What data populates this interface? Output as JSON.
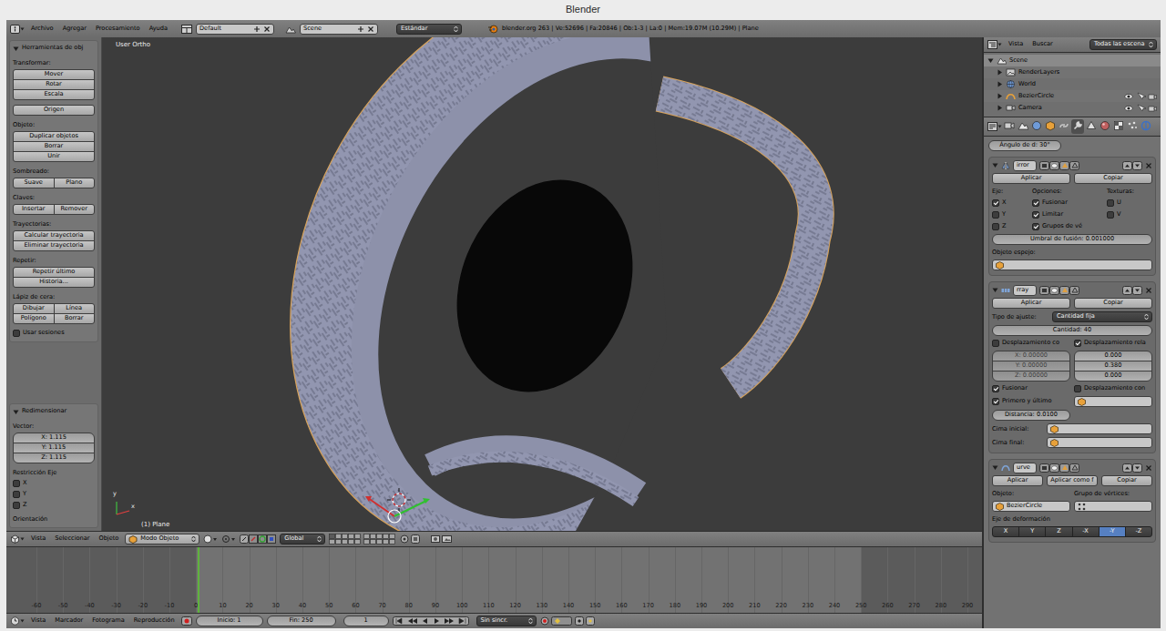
{
  "window": {
    "title": "Blender"
  },
  "info_header": {
    "menus": [
      "Archivo",
      "Agregar",
      "Procesamiento",
      "Ayuda"
    ],
    "screen": "Default",
    "scene": "Scene",
    "engine": "Estándar",
    "stats": "blender.org 263 | Ve:52696 | Fa:20846 | Ob:1-3 | La:0 | Mem:19.07M (10.29M) | Plane"
  },
  "tool_shelf": {
    "title": "Herramientas de obj",
    "expanded": true,
    "sections": [
      {
        "label": "Transformar:",
        "rows": [
          [
            "Mover"
          ],
          [
            "Rotar"
          ],
          [
            "Escala"
          ]
        ]
      },
      {
        "rows": [
          [
            "Origen"
          ]
        ]
      },
      {
        "label": "Objeto:",
        "rows": [
          [
            "Duplicar objetos"
          ],
          [
            "Borrar"
          ],
          [
            "Unir"
          ]
        ]
      },
      {
        "label": "Sombreado:",
        "rows": [
          [
            "Suave",
            "Plano"
          ]
        ]
      },
      {
        "label": "Claves:",
        "rows": [
          [
            "Insertar",
            "Remover"
          ]
        ]
      },
      {
        "label": "Trayectorias:",
        "rows": [
          [
            "Calcular trayectoria"
          ],
          [
            "Eliminar trayectoria"
          ]
        ]
      },
      {
        "label": "Repetir:",
        "rows": [
          [
            "Repetir último"
          ],
          [
            "Historia..."
          ]
        ]
      },
      {
        "label": "Lápiz de cera:",
        "rows": [
          [
            "Dibujar",
            "Línea"
          ],
          [
            "Polígono",
            "Borrar"
          ]
        ],
        "checks": [
          {
            "label": "Usar sesiones",
            "checked": false
          }
        ]
      }
    ]
  },
  "operator_panel": {
    "title": "Redimensionar",
    "expanded": true,
    "vector_label": "Vector:",
    "fields": [
      "X: 1.115",
      "Y: 1.115",
      "Z: 1.115"
    ],
    "constraint_label": "Restricción Eje",
    "axes": [
      {
        "label": "X",
        "checked": false
      },
      {
        "label": "Y",
        "checked": false
      },
      {
        "label": "Z",
        "checked": false
      }
    ],
    "orientation_label": "Orientación"
  },
  "viewport": {
    "view_label": "User Ortho",
    "object_label": "(1) Plane",
    "axis_labels": [
      "y",
      "x"
    ]
  },
  "view_header": {
    "menus": [
      "Vista",
      "Seleccionar",
      "Objeto"
    ],
    "mode": "Modo Objeto",
    "orientation": "Global"
  },
  "timeline": {
    "ticks": [
      "-60",
      "-50",
      "-40",
      "-30",
      "-20",
      "-10",
      "0",
      "10",
      "20",
      "30",
      "40",
      "50",
      "60",
      "70",
      "80",
      "90",
      "100",
      "110",
      "120",
      "130",
      "140",
      "150",
      "160",
      "170",
      "180",
      "190",
      "200",
      "210",
      "220",
      "230",
      "240",
      "250",
      "260",
      "270",
      "280",
      "290"
    ]
  },
  "timeline_header": {
    "menus": [
      "Vista",
      "Marcador",
      "Fotograma",
      "Reproducción"
    ],
    "start": "Inicio: 1",
    "end": "Fin: 250",
    "current_frame": "1",
    "sync": "Sin sincr."
  },
  "outliner": {
    "menus": [
      "Vista",
      "Buscar"
    ],
    "filter": "Todas las escena",
    "items": [
      {
        "label": "Scene",
        "kind": "scene",
        "expanded": true,
        "selected": true,
        "visible": false
      },
      {
        "label": "RenderLayers",
        "kind": "renderlayers",
        "expanded": false,
        "selected": false,
        "visible": false
      },
      {
        "label": "World",
        "kind": "world",
        "expanded": false,
        "selected": false,
        "visible": false
      },
      {
        "label": "BezierCircle",
        "kind": "curve",
        "expanded": false,
        "selected": false,
        "visible": true
      },
      {
        "label": "Camera",
        "kind": "camera",
        "expanded": false,
        "selected": false,
        "visible": true
      }
    ]
  },
  "properties": {
    "tabs": [
      {
        "kind": "render",
        "selected": false
      },
      {
        "kind": "scene",
        "selected": false
      },
      {
        "kind": "world",
        "selected": false
      },
      {
        "kind": "object",
        "selected": false
      },
      {
        "kind": "constraints",
        "selected": false
      },
      {
        "kind": "modifiers",
        "selected": true
      },
      {
        "kind": "data",
        "selected": false
      },
      {
        "kind": "material",
        "selected": false
      },
      {
        "kind": "texture",
        "selected": false
      },
      {
        "kind": "particles",
        "selected": false
      },
      {
        "kind": "physics",
        "selected": false
      }
    ],
    "top_field": "Ángulo de d: 30°",
    "modifiers": [
      {
        "kind": "mirror",
        "name": "irror",
        "expanded": true,
        "buttons": [
          "Aplicar",
          "Copiar"
        ],
        "columns": [
          {
            "title": "Eje:",
            "checks": [
              {
                "label": "X",
                "checked": true
              },
              {
                "label": "Y",
                "checked": false
              },
              {
                "label": "Z",
                "checked": false
              }
            ]
          },
          {
            "title": "Opciones:",
            "checks": [
              {
                "label": "Fusionar",
                "checked": true
              },
              {
                "label": "Limitar",
                "checked": true
              },
              {
                "label": "Grupos de vé",
                "checked": true
              }
            ]
          },
          {
            "title": "Texturas:",
            "checks": [
              {
                "label": "U",
                "checked": false
              },
              {
                "label": "V",
                "checked": false
              }
            ]
          }
        ],
        "merge_limit": "Umbral de fusión: 0.001000",
        "object_label": "Objeto espejo:"
      },
      {
        "kind": "array",
        "name": "rray",
        "expanded": true,
        "buttons": [
          "Aplicar",
          "Copiar"
        ],
        "fit_label": "Tipo de ajuste:",
        "fit_value": "Cantidad fija",
        "count": "Cantidad: 40",
        "offsets": [
          {
            "label": "Desplazamiento co",
            "checked": false,
            "values": [
              "X: 0.00000",
              "Y: 0.00000",
              "Z: 0.00000"
            ]
          },
          {
            "label": "Desplazamiento rela",
            "checked": true,
            "values": [
              "0.000",
              "0.380",
              "0.000"
            ]
          }
        ],
        "merge": {
          "label": "Fusionar",
          "checked": true
        },
        "object_offset": {
          "label": "Desplazamiento con",
          "checked": false
        },
        "first_last": {
          "label": "Primero y último",
          "checked": true
        },
        "distance": "Distancia: 0.0100",
        "caps": [
          "Cima inicial:",
          "Cima final:"
        ]
      },
      {
        "kind": "curve",
        "name": "urve",
        "expanded": true,
        "buttons": [
          "Aplicar",
          "Aplicar como f",
          "Copiar"
        ],
        "object_label": "Objeto:",
        "object_value": "BezierCircle",
        "vgroup_label": "Grupo de vértices:",
        "axis_label": "Eje de deformación",
        "axes": [
          {
            "label": "X",
            "selected": false
          },
          {
            "label": "Y",
            "selected": false
          },
          {
            "label": "Z",
            "selected": false
          },
          {
            "label": "-X",
            "selected": false
          },
          {
            "label": "-Y",
            "selected": true
          },
          {
            "label": "-Z",
            "selected": false
          }
        ]
      }
    ]
  }
}
